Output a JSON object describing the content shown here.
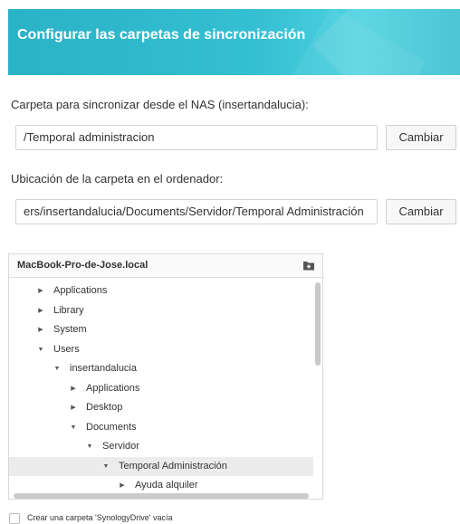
{
  "header": {
    "title": "Configurar las carpetas de sincronización"
  },
  "nas_folder": {
    "label": "Carpeta para sincronizar desde el NAS (insertandalucia):",
    "value": "/Temporal administracion",
    "button": "Cambiar"
  },
  "local_folder": {
    "label": "Ubicación de la carpeta en el ordenador:",
    "value": "ers/insertandalucia/Documents/Servidor/Temporal Administración",
    "button": "Cambiar"
  },
  "tree": {
    "host": "MacBook-Pro-de-Jose.local",
    "new_folder_icon": "new-folder-icon",
    "items": [
      {
        "label": "Applications",
        "expanded": false,
        "selected": false
      },
      {
        "label": "Library",
        "expanded": false,
        "selected": false
      },
      {
        "label": "System",
        "expanded": false,
        "selected": false
      },
      {
        "label": "Users",
        "expanded": true,
        "selected": false
      },
      {
        "label": "insertandalucia",
        "expanded": true,
        "selected": false
      },
      {
        "label": "Applications",
        "expanded": false,
        "selected": false
      },
      {
        "label": "Desktop",
        "expanded": false,
        "selected": false
      },
      {
        "label": "Documents",
        "expanded": true,
        "selected": false
      },
      {
        "label": "Servidor",
        "expanded": true,
        "selected": false
      },
      {
        "label": "Temporal Administración",
        "expanded": true,
        "selected": true
      },
      {
        "label": "Ayuda alquiler",
        "expanded": false,
        "selected": false
      }
    ]
  },
  "checkbox": {
    "label": "Crear una carpeta 'SynologyDrive' vacía",
    "checked": false
  },
  "colors": {
    "header_accent": "#35bfd2",
    "selection": "#ececec"
  }
}
